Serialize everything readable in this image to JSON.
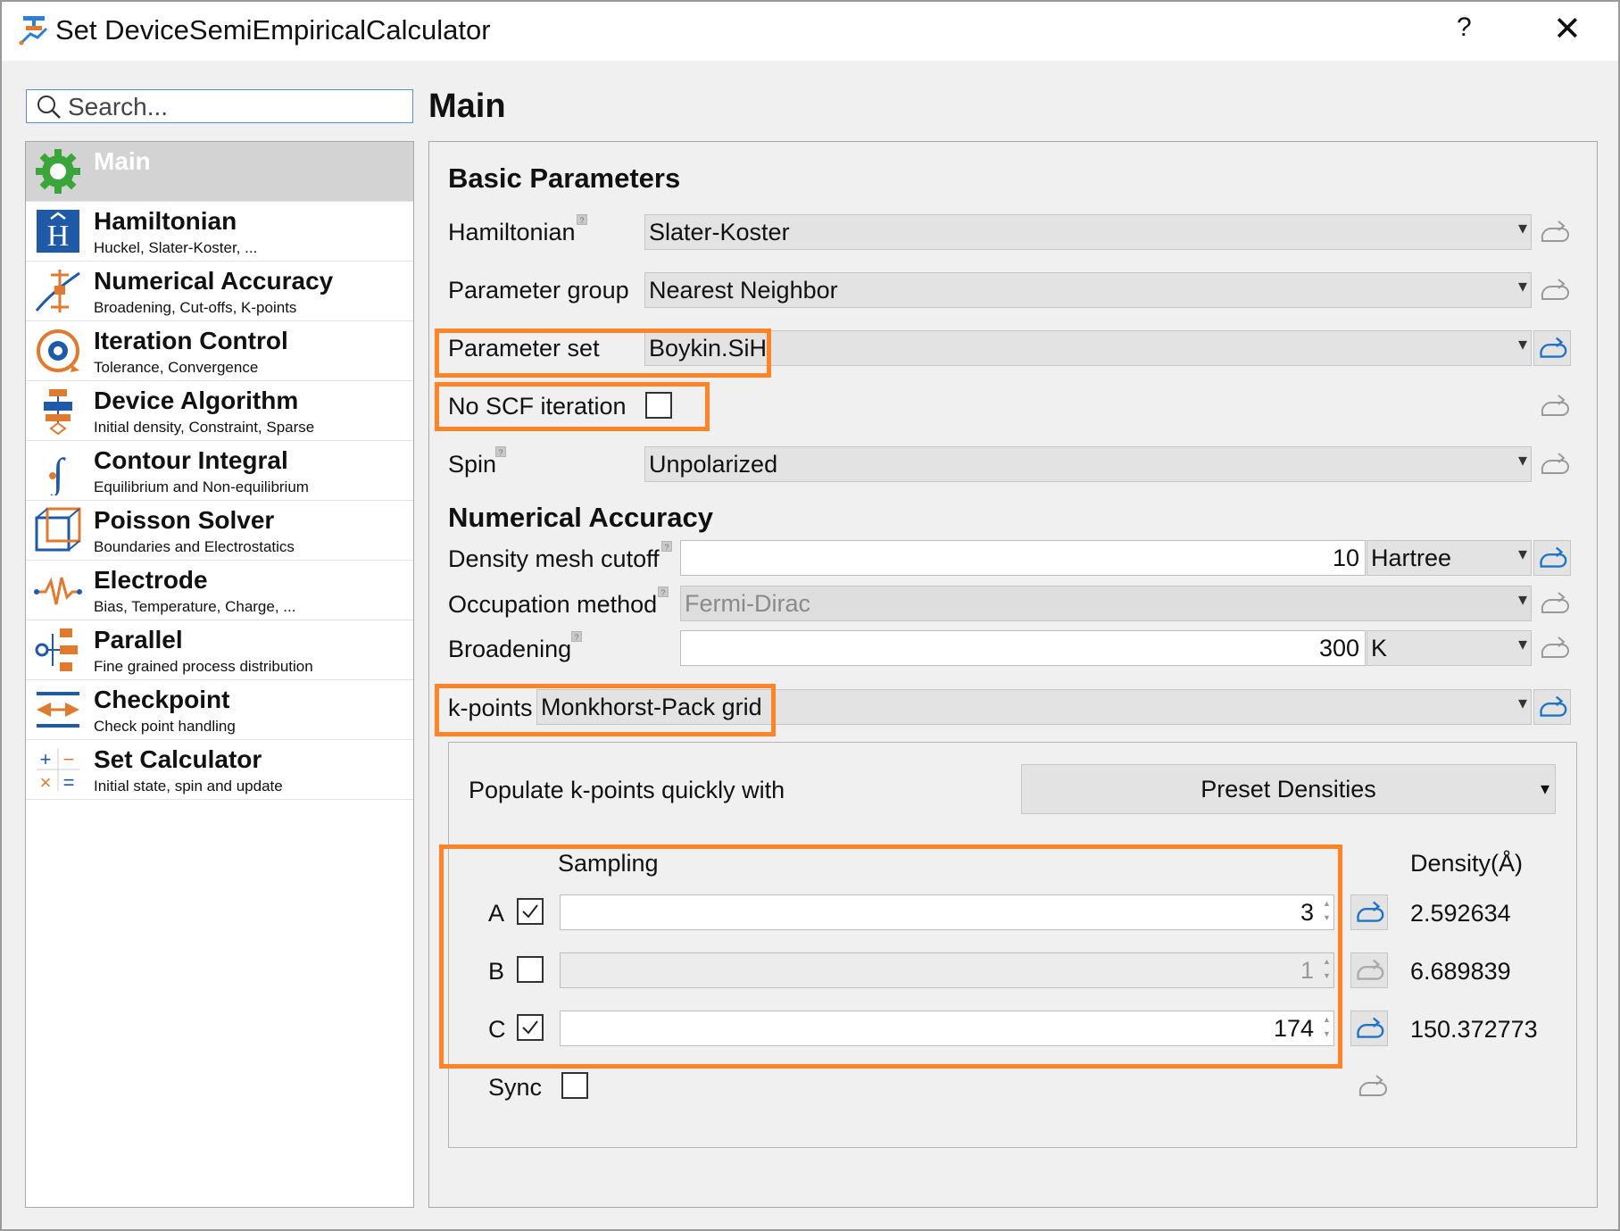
{
  "window": {
    "title": "Set DeviceSemiEmpiricalCalculator",
    "help": "?",
    "close": "✕"
  },
  "search": {
    "placeholder": "Search..."
  },
  "sidebar": {
    "items": [
      {
        "title": "Main",
        "subtitle": "",
        "icon": "gear-icon"
      },
      {
        "title": "Hamiltonian",
        "subtitle": "Huckel, Slater-Koster, ...",
        "icon": "hamiltonian-icon"
      },
      {
        "title": "Numerical Accuracy",
        "subtitle": "Broadening, Cut-offs, K-points",
        "icon": "numerical-accuracy-icon"
      },
      {
        "title": "Iteration Control",
        "subtitle": "Tolerance, Convergence",
        "icon": "iteration-icon"
      },
      {
        "title": "Device Algorithm",
        "subtitle": "Initial density, Constraint, Sparse",
        "icon": "device-algorithm-icon"
      },
      {
        "title": "Contour Integral",
        "subtitle": "Equilibrium and Non-equilibrium",
        "icon": "integral-icon"
      },
      {
        "title": "Poisson Solver",
        "subtitle": "Boundaries and Electrostatics",
        "icon": "cube-icon"
      },
      {
        "title": "Electrode",
        "subtitle": "Bias, Temperature, Charge, ...",
        "icon": "electrode-icon"
      },
      {
        "title": "Parallel",
        "subtitle": "Fine grained process distribution",
        "icon": "parallel-icon"
      },
      {
        "title": "Checkpoint",
        "subtitle": "Check point handling",
        "icon": "checkpoint-icon"
      },
      {
        "title": "Set Calculator",
        "subtitle": "Initial state, spin  and update",
        "icon": "calculator-icon"
      }
    ]
  },
  "main": {
    "title": "Main",
    "basic": {
      "heading": "Basic Parameters",
      "hamiltonian": {
        "label": "Hamiltonian",
        "value": "Slater-Koster"
      },
      "parameter_group": {
        "label": "Parameter group",
        "value": "Nearest Neighbor"
      },
      "parameter_set": {
        "label": "Parameter set",
        "value": "Boykin.SiH"
      },
      "no_scf": {
        "label": "No SCF iteration",
        "checked": false
      },
      "spin": {
        "label": "Spin",
        "value": "Unpolarized"
      }
    },
    "numerical": {
      "heading": "Numerical Accuracy",
      "density_mesh_cutoff": {
        "label": "Density mesh cutoff",
        "value": "10",
        "unit": "Hartree"
      },
      "occupation_method": {
        "label": "Occupation method",
        "value": "Fermi-Dirac"
      },
      "broadening": {
        "label": "Broadening",
        "value": "300",
        "unit": "K"
      },
      "kpoints": {
        "label": "k-points",
        "value": "Monkhorst-Pack grid",
        "populate_label": "Populate k-points quickly with",
        "preset_button": "Preset Densities",
        "sampling_header": "Sampling",
        "density_header": "Density(Å)",
        "rows": [
          {
            "axis": "A",
            "checked": true,
            "value": "3",
            "density": "2.592634"
          },
          {
            "axis": "B",
            "checked": false,
            "value": "1",
            "density": "6.689839"
          },
          {
            "axis": "C",
            "checked": true,
            "value": "174",
            "density": "150.372773"
          }
        ],
        "sync_label": "Sync"
      }
    }
  },
  "colors": {
    "highlight": "#ff8427",
    "accent": "#1f73c7"
  }
}
